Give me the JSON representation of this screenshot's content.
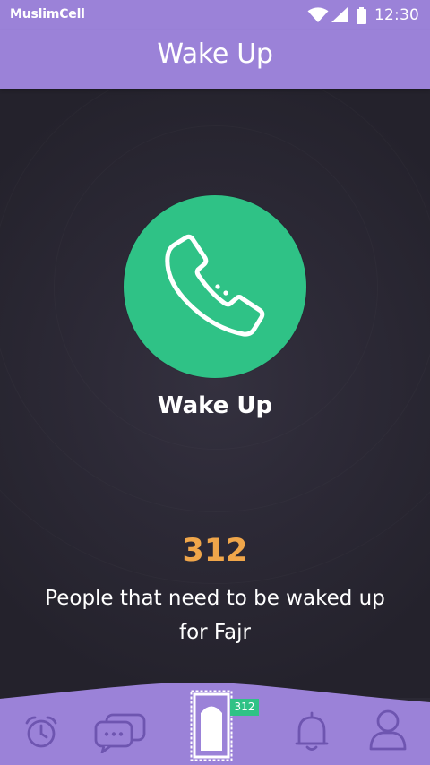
{
  "status_bar": {
    "carrier": "MuslimCell",
    "time": "12:30",
    "icons": [
      "wifi-icon",
      "signal-icon",
      "battery-icon"
    ]
  },
  "header": {
    "title": "Wake Up"
  },
  "main": {
    "call_button_icon": "phone-icon",
    "call_label": "Wake Up",
    "people_count": "312",
    "people_text": "People that need to be waked up for Fajr"
  },
  "bottom_nav": {
    "items": [
      {
        "name": "alarm",
        "icon": "alarm-clock-icon"
      },
      {
        "name": "chat",
        "icon": "chat-icon"
      },
      {
        "name": "prayer",
        "icon": "prayer-mat-icon",
        "badge": "312"
      },
      {
        "name": "notifications",
        "icon": "bell-icon"
      },
      {
        "name": "profile",
        "icon": "user-icon"
      }
    ]
  },
  "colors": {
    "primary": "#9b82d8",
    "background": "#2a2833",
    "accent_green": "#2fc286",
    "accent_orange": "#f0a64a",
    "nav_icon": "#6e55b0"
  }
}
